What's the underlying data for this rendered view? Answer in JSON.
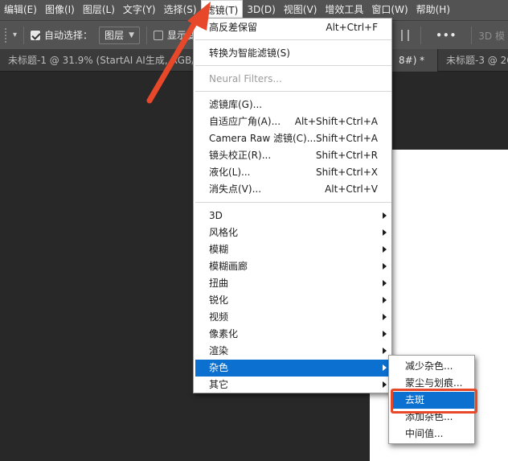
{
  "menubar": {
    "items": [
      "编辑(E)",
      "图像(I)",
      "图层(L)",
      "文字(Y)",
      "选择(S)",
      "滤镜(T)",
      "3D(D)",
      "视图(V)",
      "增效工具",
      "窗口(W)",
      "帮助(H)"
    ],
    "active_index": 5
  },
  "options_bar": {
    "auto_select_label": "自动选择：",
    "auto_select_checked": true,
    "target_value": "图层",
    "show_transform_label": "显示变",
    "more_label": "•••",
    "mode_3d_label": "3D 模"
  },
  "tabs": [
    {
      "title": "未标题-1 @ 31.9% (StartAI AI生成, RGB/8#)"
    },
    {
      "title": "8#) *",
      "close": "×"
    },
    {
      "title": "未标题-3 @ 26"
    }
  ],
  "filter_menu": {
    "items": [
      {
        "label": "高反差保留",
        "shortcut": "Alt+Ctrl+F"
      },
      {
        "label": "转换为智能滤镜(S)"
      },
      {
        "label": "Neural Filters...",
        "disabled": true
      },
      {
        "label": "滤镜库(G)..."
      },
      {
        "label": "自适应广角(A)...",
        "shortcut": "Alt+Shift+Ctrl+A"
      },
      {
        "label": "Camera Raw 滤镜(C)...",
        "shortcut": "Shift+Ctrl+A"
      },
      {
        "label": "镜头校正(R)...",
        "shortcut": "Shift+Ctrl+R"
      },
      {
        "label": "液化(L)...",
        "shortcut": "Shift+Ctrl+X"
      },
      {
        "label": "消失点(V)...",
        "shortcut": "Alt+Ctrl+V"
      },
      {
        "label": "3D"
      },
      {
        "label": "风格化"
      },
      {
        "label": "模糊"
      },
      {
        "label": "模糊画廊"
      },
      {
        "label": "扭曲"
      },
      {
        "label": "锐化"
      },
      {
        "label": "视频"
      },
      {
        "label": "像素化"
      },
      {
        "label": "渲染"
      },
      {
        "label": "杂色"
      },
      {
        "label": "其它"
      }
    ]
  },
  "noise_submenu": {
    "items": [
      {
        "label": "减少杂色..."
      },
      {
        "label": "蒙尘与划痕..."
      },
      {
        "label": "去斑"
      },
      {
        "label": "添加杂色..."
      },
      {
        "label": "中间值..."
      }
    ],
    "highlighted_index": 2
  },
  "colors": {
    "highlight": "#0b70d0",
    "annotation_red": "#e8482a"
  }
}
